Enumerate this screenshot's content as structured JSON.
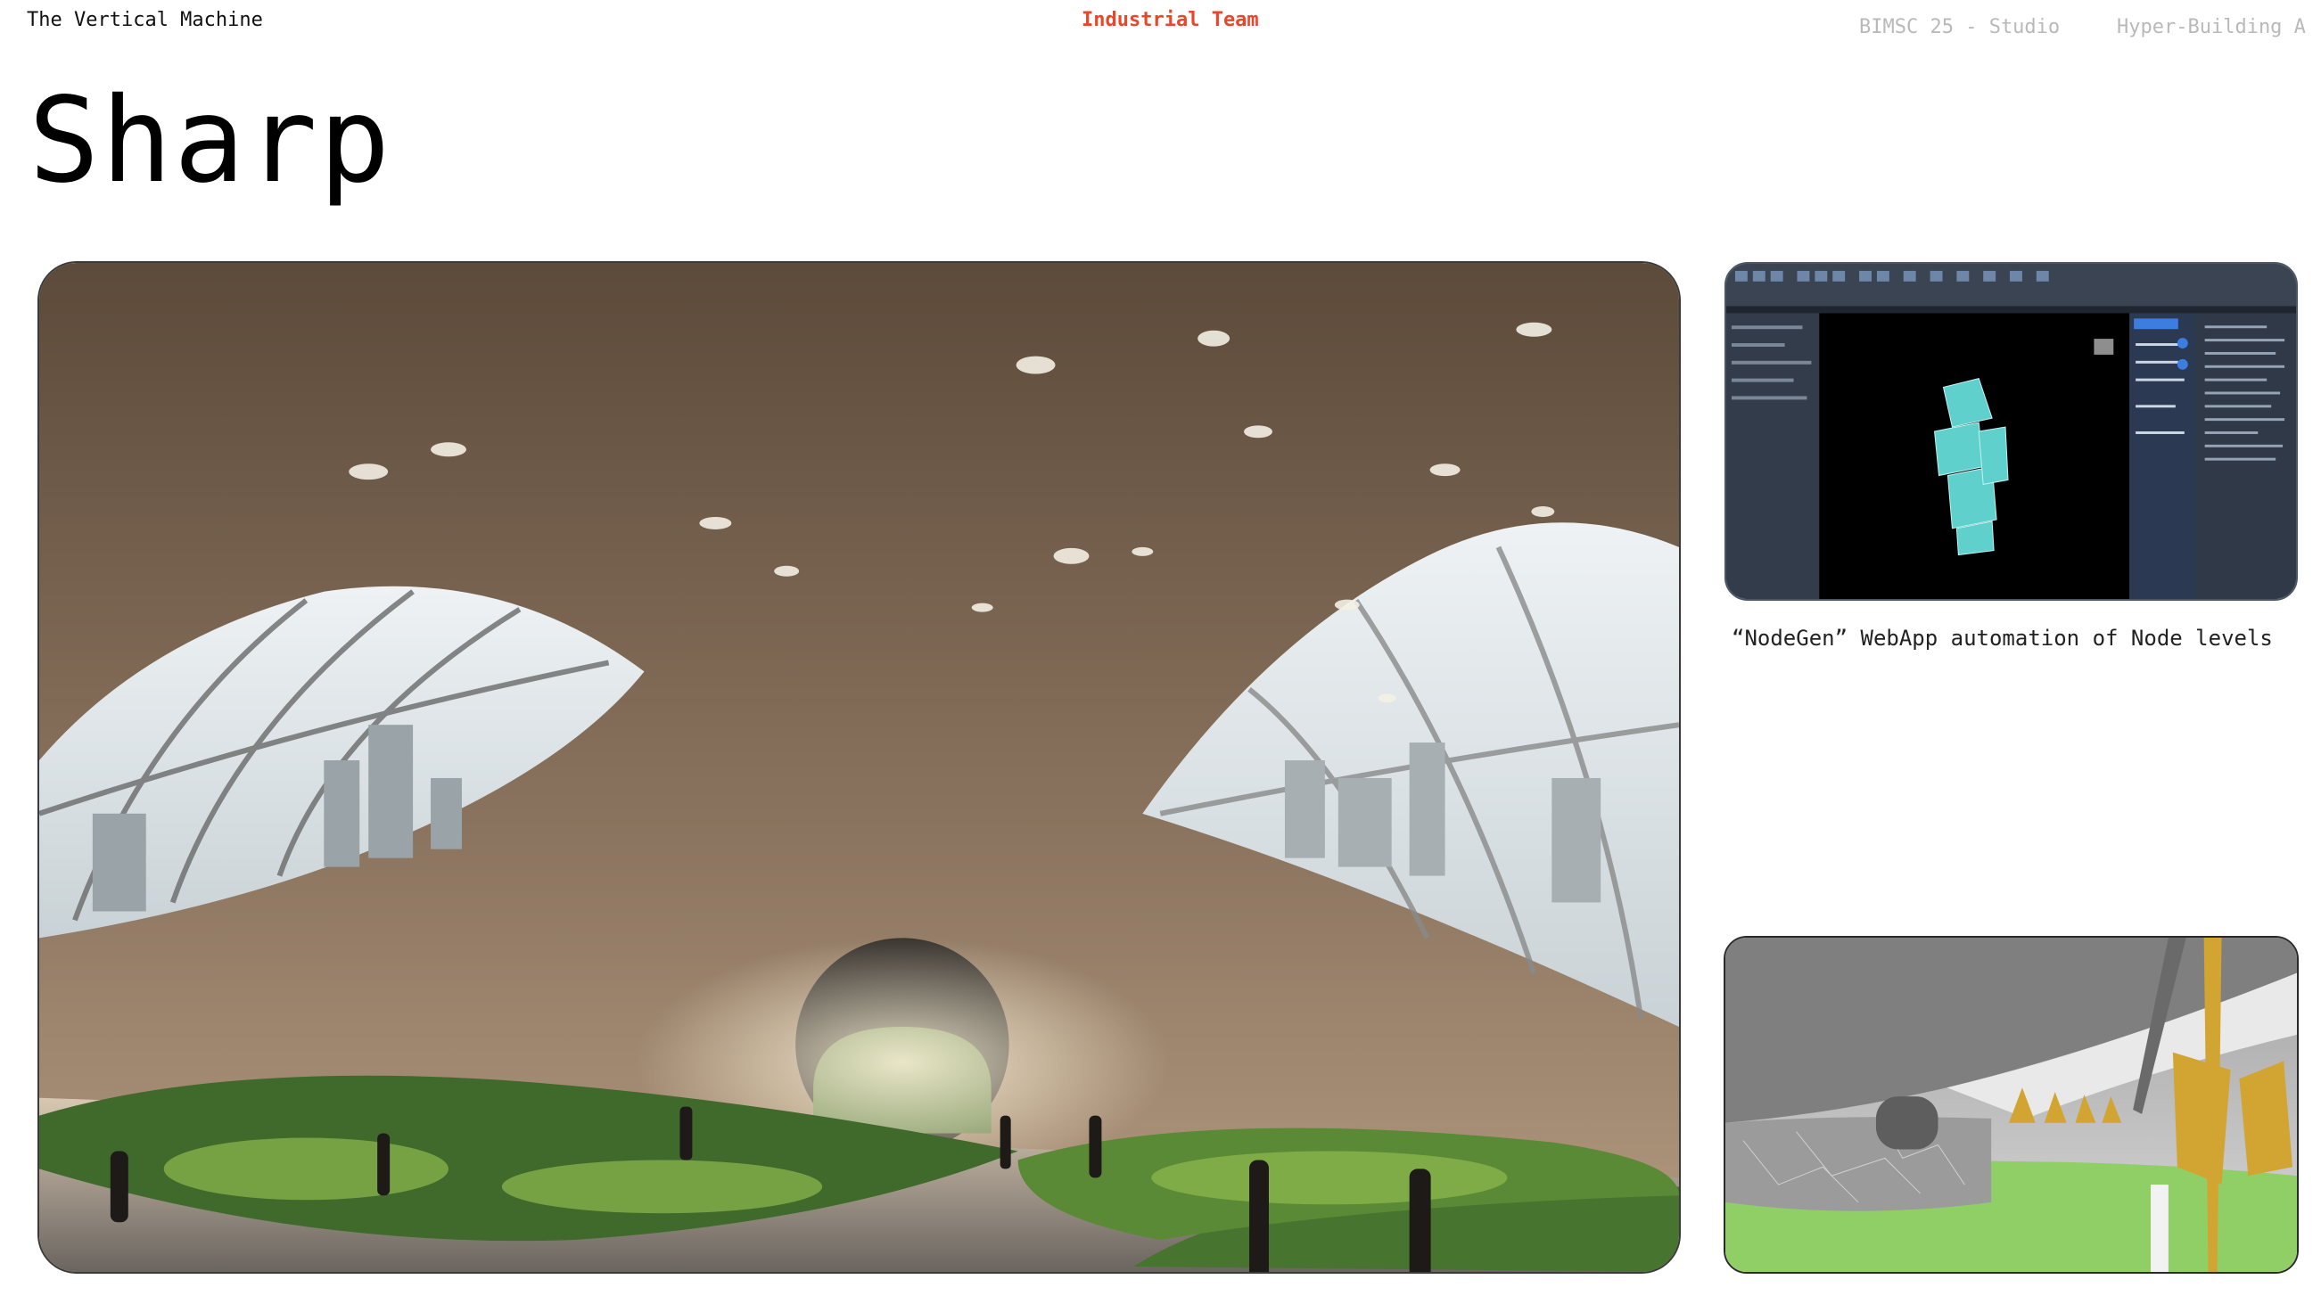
{
  "header": {
    "project": "The Vertical Machine",
    "team": "Industrial Team",
    "course": "BIMSC 25 - Studio",
    "building": "Hyper-Building A"
  },
  "page": {
    "title": "Sharp"
  },
  "software_screenshot": {
    "caption": "“NodeGen” WebApp automation of Node levels"
  },
  "colors": {
    "team_accent": "#e8472c",
    "secondary_text": "#b9b9b9",
    "model_cyan": "#5fd0cc",
    "render_yellow": "#d2a431",
    "render_grass": "#8fcf66"
  }
}
